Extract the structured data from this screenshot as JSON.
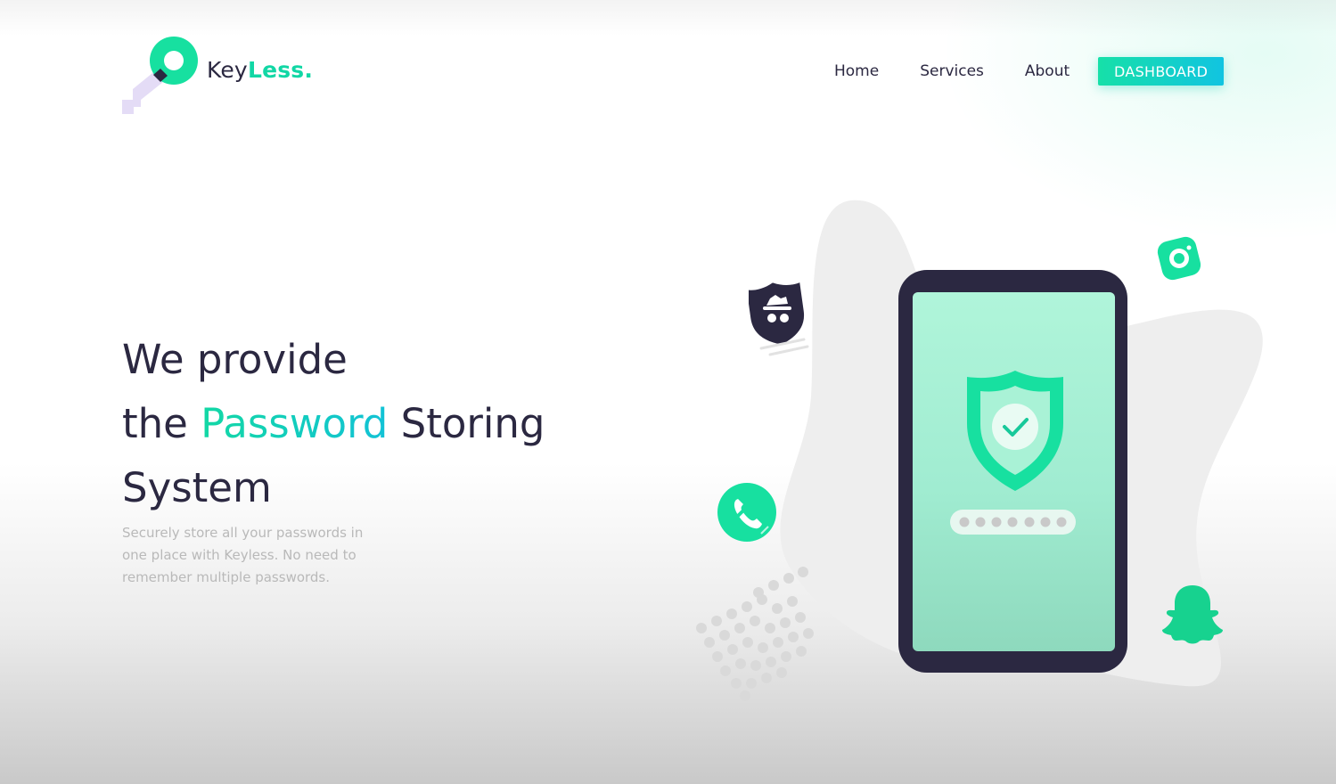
{
  "brand": {
    "name_part1": "Key",
    "name_part2": "Less."
  },
  "nav": {
    "items": [
      {
        "label": "Home"
      },
      {
        "label": "Services"
      },
      {
        "label": "About"
      }
    ],
    "cta_label": "DASHBOARD"
  },
  "hero": {
    "line1": "We provide",
    "line2_prefix": "the ",
    "line2_accent": "Password",
    "line2_suffix": " Storing",
    "line3": "System",
    "subtext": "Securely store all your passwords in one place with Keyless. No need to remember multiple passwords."
  },
  "colors": {
    "accent_green": "#12d7a5",
    "accent_cyan": "#11c4e1",
    "dark": "#2b2841",
    "phone_screen": "#a8f2d6"
  },
  "icons": [
    "key-logo-icon",
    "spy-shield-icon",
    "camera-app-icon",
    "phone-call-icon",
    "snapchat-ghost-icon",
    "shield-check-icon"
  ]
}
